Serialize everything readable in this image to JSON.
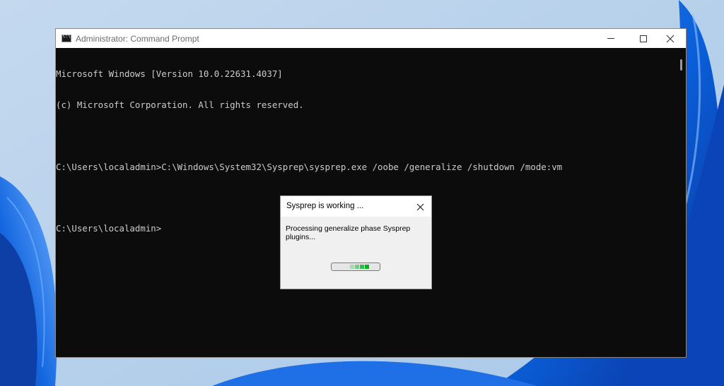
{
  "window": {
    "title": "Administrator: Command Prompt",
    "icon": "cmd-icon",
    "controls": [
      "minimize",
      "maximize",
      "close"
    ]
  },
  "console": {
    "lines": [
      "Microsoft Windows [Version 10.0.22631.4037]",
      "(c) Microsoft Corporation. All rights reserved.",
      "",
      "C:\\Users\\localadmin>C:\\Windows\\System32\\Sysprep\\sysprep.exe /oobe /generalize /shutdown /mode:vm",
      "",
      "C:\\Users\\localadmin>"
    ],
    "text_color": "#cccccc",
    "background": "#0c0c0c"
  },
  "dialog": {
    "title": "Sysprep is working ...",
    "message": "Processing generalize phase Sysprep\nplugins...",
    "progress": {
      "style": "marquee",
      "color": "#06b025",
      "blocks": [
        {
          "opacity": 0.25
        },
        {
          "opacity": 0.5
        },
        {
          "opacity": 0.8
        },
        {
          "opacity": 1.0
        }
      ]
    }
  }
}
